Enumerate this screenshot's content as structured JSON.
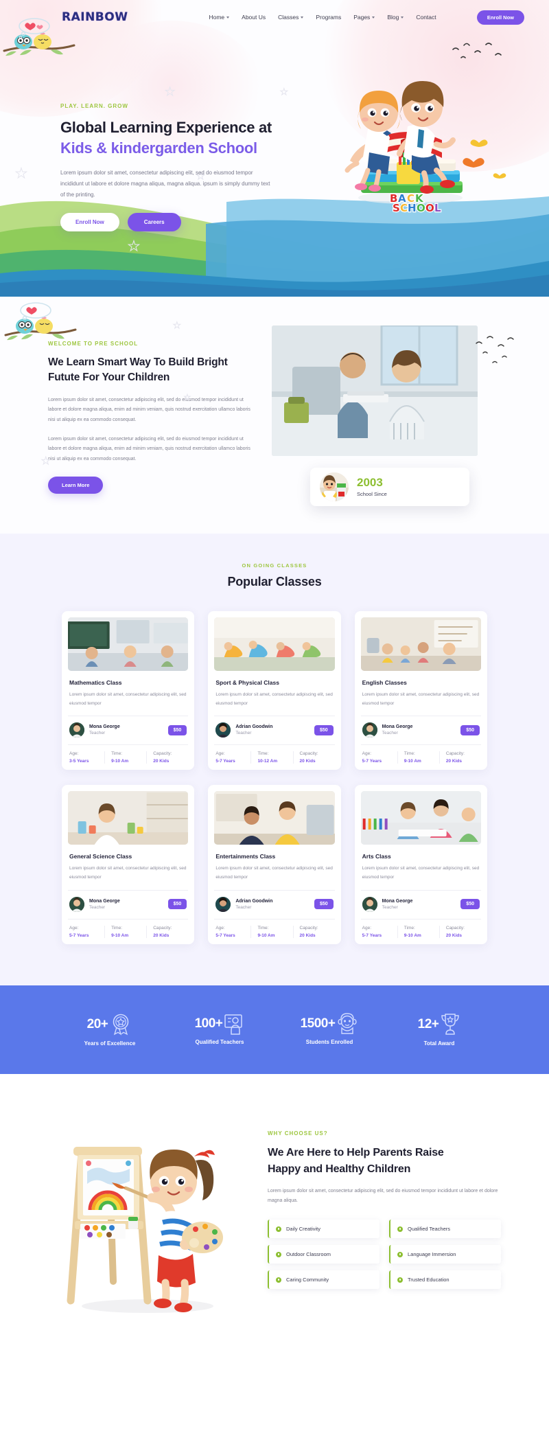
{
  "brand": {
    "logo": "RAINBOW",
    "accent": "#7b53e8",
    "green": "#8dbf32",
    "blue": "#5a78ea"
  },
  "nav": {
    "items": [
      {
        "label": "Home",
        "caret": true
      },
      {
        "label": "About Us",
        "caret": false
      },
      {
        "label": "Classes",
        "caret": true
      },
      {
        "label": "Programs",
        "caret": false
      },
      {
        "label": "Pages",
        "caret": true
      },
      {
        "label": "Blog",
        "caret": true
      },
      {
        "label": "Contact",
        "caret": false
      }
    ],
    "cta": "Enroll Now"
  },
  "hero": {
    "eyebrow": "PLAY. LEARN. GROW",
    "title_line1": "Global Learning Experience at",
    "title_line2": "Kids & kindergarden School",
    "paragraph": "Lorem ipsum dolor sit amet, consectetur adipiscing elit, sed do eiusmod tempor incididunt ut labore et dolore magna aliqua, magna aliqua. ipsum is simply dummy text of the printing.",
    "btn_primary": "Enroll Now",
    "btn_secondary": "Careers",
    "illustration": "kids-sitting-on-books-back-to-school"
  },
  "about": {
    "eyebrow": "WELCOME TO PRE SCHOOL",
    "title_line1": "We Learn Smart Way To Build Bright",
    "title_line2": "Futute For Your Children",
    "paragraph1": "Lorem ipsum dolor sit amet, consectetur adipiscing elit, sed do eiusmod tempor incididunt ut labore et dolore magna aliqua, enim ad minim veniam, quis nostrud exercitation ullamco laboris nisi ut aliquip ex ea commodo consequat.",
    "paragraph2": "Lorem ipsum dolor sit amet, consectetur adipiscing elit, sed do eiusmod tempor incididunt ut labore et dolore magna aliqua, enim ad minim veniam, quis nostrud exercitation ullamco laboris nisi ut aliquip ex ea commodo consequat.",
    "button": "Learn More",
    "photo": "children-reading-book-in-classroom",
    "since_year": "2003",
    "since_label": "School Since",
    "since_avatar": "girl-with-painted-hands"
  },
  "classes": {
    "eyebrow": "ON GOING CLASSES",
    "title": "Popular Classes",
    "labels": {
      "age": "Age:",
      "time": "Time:",
      "capacity": "Capacity:",
      "role": "Teacher"
    },
    "cards": [
      {
        "title": "Mathematics Class",
        "desc": "Lorem ipsum dolor sit amet, consectetur adipiscing elit, sed eiusmod tempor",
        "teacher": "Mona George",
        "role": "Teacher",
        "price": "$50",
        "age": "3-5 Years",
        "time": "9-10 Am",
        "capacity": "20 Kids",
        "image": "classroom-with-chalkboard"
      },
      {
        "title": "Sport & Physical Class",
        "desc": "Lorem ipsum dolor sit amet, consectetur adipiscing elit, sed eiusmod tempor",
        "teacher": "Adrian Goodwin",
        "role": "Teacher",
        "price": "$50",
        "age": "5-7 Years",
        "time": "10-12 Am",
        "capacity": "20 Kids",
        "image": "children-doing-gymnastics"
      },
      {
        "title": "English Classes",
        "desc": "Lorem ipsum dolor sit amet, consectetur adipiscing elit, sed eiusmod tempor",
        "teacher": "Mona George",
        "role": "Teacher",
        "price": "$50",
        "age": "5-7 Years",
        "time": "9-10 Am",
        "capacity": "20 Kids",
        "image": "teacher-reading-to-children"
      },
      {
        "title": "General Science Class",
        "desc": "Lorem ipsum dolor sit amet, consectetur adipiscing elit, sed eiusmod tempor",
        "teacher": "Mona George",
        "role": "Teacher",
        "price": "$50",
        "age": "5-7 Years",
        "time": "9-10 Am",
        "capacity": "20 Kids",
        "image": "child-doing-science-experiment"
      },
      {
        "title": "Entertainments Class",
        "desc": "Lorem ipsum dolor sit amet, consectetur adipiscing elit, sed eiusmod tempor",
        "teacher": "Adrian Goodwin",
        "role": "Teacher",
        "price": "$50",
        "age": "5-7 Years",
        "time": "9-10 Am",
        "capacity": "20 Kids",
        "image": "children-playing-indoors"
      },
      {
        "title": "Arts Class",
        "desc": "Lorem ipsum dolor sit amet, consectetur adipiscing elit, sed eiusmod tempor",
        "teacher": "Mona George",
        "role": "Teacher",
        "price": "$50",
        "age": "5-7 Years",
        "time": "9-10 Am",
        "capacity": "20 Kids",
        "image": "children-painting-at-table"
      }
    ]
  },
  "stats": [
    {
      "number": "20+",
      "label": "Years of Excellence",
      "icon": "award-ribbon-icon"
    },
    {
      "number": "100+",
      "label": "Qualified Teachers",
      "icon": "teacher-board-icon"
    },
    {
      "number": "1500+",
      "label": "Students Enrolled",
      "icon": "student-icon"
    },
    {
      "number": "12+",
      "label": "Total Award",
      "icon": "trophy-icon"
    }
  ],
  "why": {
    "eyebrow": "WHY CHOOSE US?",
    "title_line1": "We Are Here to Help Parents Raise",
    "title_line2": "Happy and Healthy Children",
    "paragraph": "Lorem ipsum dolor sit amet, consectetur adipiscing elit, sed do eiusmod tempor incididunt ut labore et dolore magna aliqua.",
    "illustration": "girl-painting-rainbow-on-easel",
    "features": [
      "Daily Creativity",
      "Qualified Teachers",
      "Outdoor Classroom",
      "Language Immersion",
      "Caring Community",
      "Trusted Education"
    ]
  }
}
